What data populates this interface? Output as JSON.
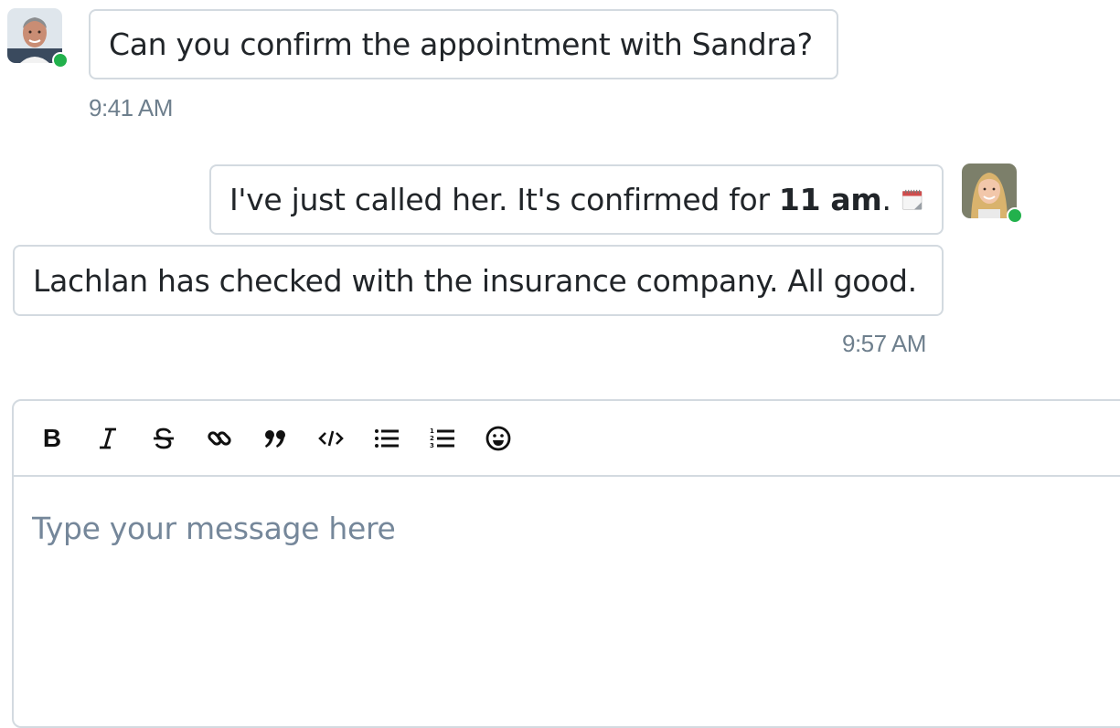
{
  "messages": [
    {
      "sender": "colleague",
      "text": "Can you confirm the appointment with Sandra?",
      "time": "9:41 AM"
    },
    {
      "sender": "me",
      "text_before": "I've just called her. It's confirmed for ",
      "text_bold": "11 am",
      "text_after": ".",
      "icon": "calendar-icon"
    },
    {
      "sender": "me",
      "text": "Lachlan has checked with the insurance company. All good.",
      "time": "9:57 AM"
    }
  ],
  "status_color": "#22b14c",
  "toolbar": {
    "bold": "B",
    "buttons": [
      "bold-icon",
      "italic-icon",
      "strikethrough-icon",
      "link-icon",
      "quote-icon",
      "code-icon",
      "bullet-list-icon",
      "numbered-list-icon",
      "emoji-icon"
    ]
  },
  "editor": {
    "placeholder": "Type your message here"
  }
}
